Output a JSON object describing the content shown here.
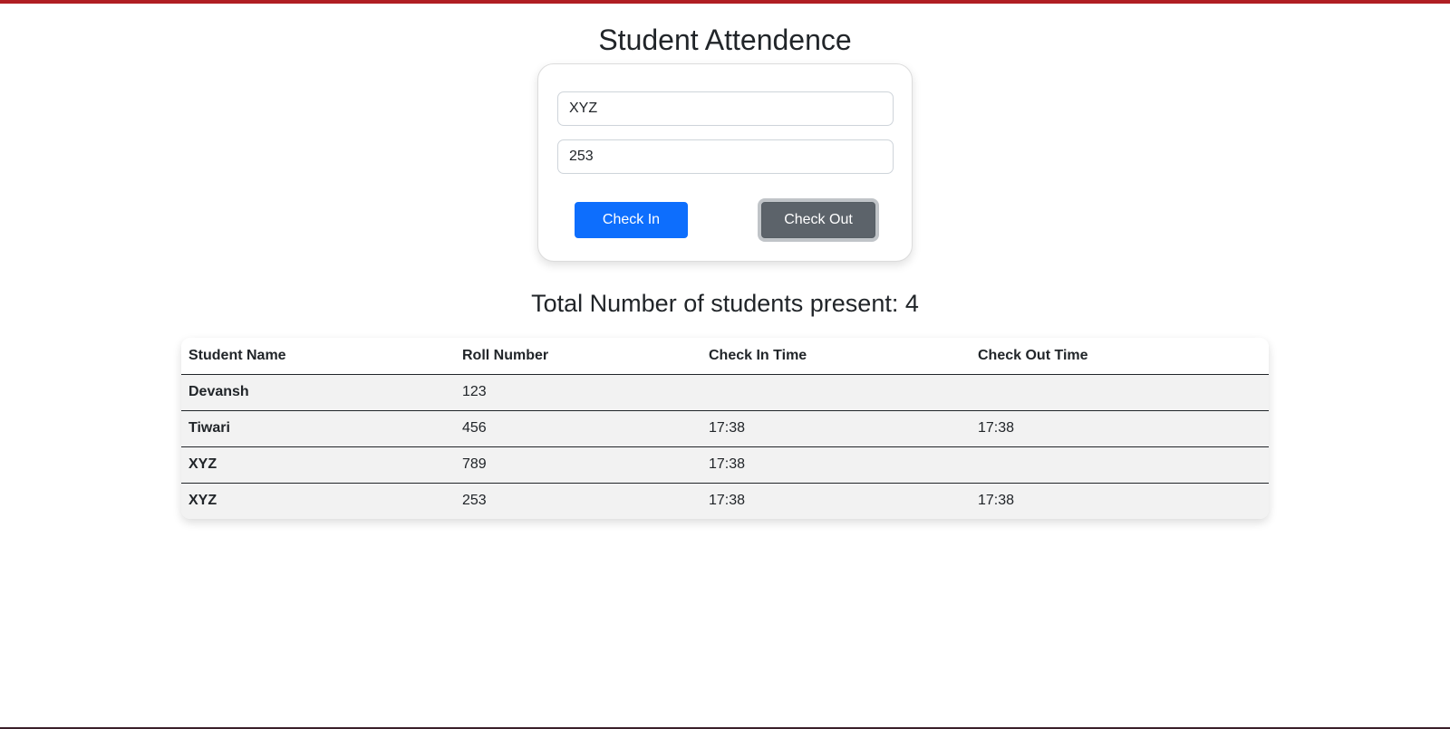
{
  "title": "Student Attendence",
  "form": {
    "name_value": "XYZ",
    "roll_value": "253",
    "check_in_label": "Check In",
    "check_out_label": "Check Out"
  },
  "summary": {
    "total_present_text": "Total Number of students present: 4"
  },
  "table": {
    "headers": [
      "Student Name",
      "Roll Number",
      "Check In Time",
      "Check Out Time"
    ],
    "rows": [
      [
        "Devansh",
        "123",
        "",
        ""
      ],
      [
        "Tiwari",
        "456",
        "17:38",
        "17:38"
      ],
      [
        "XYZ",
        "789",
        "17:38",
        ""
      ],
      [
        "XYZ",
        "253",
        "17:38",
        "17:38"
      ]
    ]
  },
  "colors": {
    "top_bar": "#b01e23",
    "check_in_button": "#0d6efd",
    "check_out_button": "#5c636a",
    "row_background": "#f2f2f2"
  }
}
